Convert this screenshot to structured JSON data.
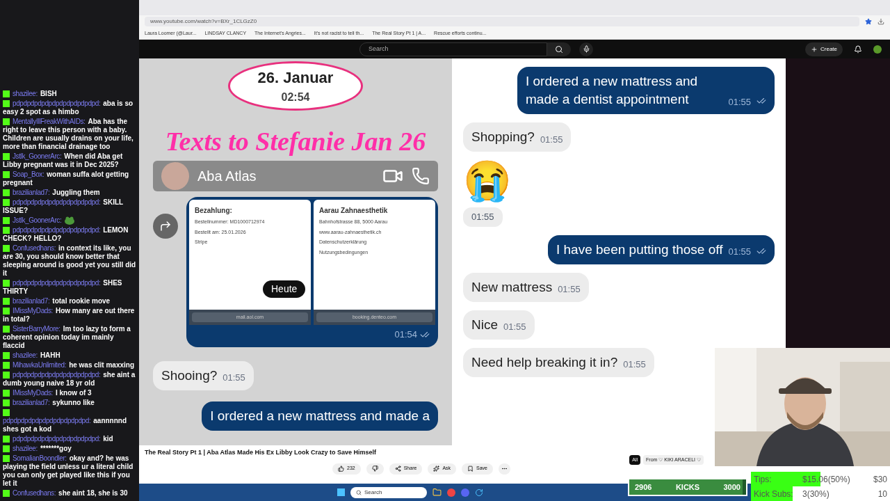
{
  "chat": [
    {
      "kind": "text",
      "user": "shazilee:",
      "text": "BISH"
    },
    {
      "kind": "text",
      "user": "pdpdpdpdpdpdpdpdpdpdpdpd:",
      "text": "aba is so easy 2 spot as a himbo"
    },
    {
      "kind": "text",
      "user": "MentallyIllFreakWithAIDs:",
      "text": "Aba has the right to leave this person with a baby. Children are usually drains on your life, more than financial drainage too"
    },
    {
      "kind": "text",
      "user": "Jstlk_GoonerArc:",
      "text": "When did Aba get Libby pregnant was it in Dec 2025?"
    },
    {
      "kind": "text",
      "user": "Soap_Box:",
      "text": "woman suffa alot getting pregnant"
    },
    {
      "kind": "text",
      "user": "brazilianlad7:",
      "text": "Juggling them"
    },
    {
      "kind": "text",
      "user": "pdpdpdpdpdpdpdpdpdpdpdpd:",
      "text": "SKILL ISSUE?"
    },
    {
      "kind": "emote",
      "user": "Jstlk_GoonerArc:"
    },
    {
      "kind": "text",
      "user": "pdpdpdpdpdpdpdpdpdpdpdpd:",
      "text": "LEMON CHECK? HELLO?"
    },
    {
      "kind": "text",
      "user": "Confusedhans:",
      "text": "in context its like, you are 30, you should know better that sleeping around is good yet you still did it"
    },
    {
      "kind": "text",
      "user": "pdpdpdpdpdpdpdpdpdpdpdpd:",
      "text": "SHES THIRTY"
    },
    {
      "kind": "text",
      "user": "brazilianlad7:",
      "text": "total rookie move"
    },
    {
      "kind": "text",
      "user": "IMissMyDads:",
      "text": "How many are out there in total?"
    },
    {
      "kind": "text",
      "user": "SisterBarryMore:",
      "text": "Im too lazy to form a coherent opinion today im mainly flaccid"
    },
    {
      "kind": "text",
      "user": "shazilee:",
      "text": "HAHH"
    },
    {
      "kind": "text",
      "user": "MihawkaUnlimited:",
      "text": "he was clit maxxing"
    },
    {
      "kind": "text",
      "user": "pdpdpdpdpdpdpdpdpdpdpdpd:",
      "text": "she aint a dumb young naive 18 yr old"
    },
    {
      "kind": "text",
      "user": "IMissMyDads:",
      "text": "I know of 3"
    },
    {
      "kind": "text",
      "user": "brazilianlad7:",
      "text": "sykunno like"
    },
    {
      "kind": "text",
      "user": "pdpdpdpdpdpdpdpdpdpdpdpd:",
      "text": "aannnnnd shes got a kod"
    },
    {
      "kind": "text",
      "user": "pdpdpdpdpdpdpdpdpdpdpdpd:",
      "text": "kid"
    },
    {
      "kind": "text",
      "user": "shazilee:",
      "text": "*******goy"
    },
    {
      "kind": "text",
      "user": "SomalianBoondler:",
      "text": "okay and? he was playing the field unless ur a literal child you can only get played like this if you let it"
    },
    {
      "kind": "text",
      "user": "Confusedhans:",
      "text": "she aint 18, she is 30"
    }
  ],
  "browser": {
    "url": "www.youtube.com/watch?v=BXr_1CLGzZ0",
    "bookmarks": [
      "Laura Loomer (@Laur...",
      "LINDSAY CLANCY",
      "The Internet's Angries...",
      "It's not racist to tell th...",
      "The Real Story Pt 1 | A...",
      "Rescue efforts continu..."
    ]
  },
  "youtube": {
    "search_placeholder": "Search",
    "create": "Create"
  },
  "video": {
    "left": {
      "date": "26. Januar",
      "time": "02:54",
      "overlay_title": "Texts to Stefanie Jan 26",
      "contact": "Aba Atlas",
      "day_badge": "Heute",
      "screens": [
        {
          "heading": "Bezahlung:",
          "lines": [
            "Bestellnummer: MD1000712974",
            "Bestellt am: 25.01.2026",
            "Stripe"
          ],
          "address": "mail.aol.com"
        },
        {
          "heading": "Aarau Zahnaesthetik",
          "lines": [
            "Bahnhofstrasse 88, 5000 Aarau",
            "www.aarau-zahnaesthetik.ch",
            "Datenschutzerklärung",
            "Nutzungsbedingungen"
          ],
          "address": "booking.denteo.com"
        }
      ],
      "image_time": "01:54",
      "messages": [
        {
          "kind": "received",
          "text": "Shooing?",
          "time": "01:55"
        },
        {
          "kind": "sent",
          "text": "I ordered a new mattress and made a"
        }
      ]
    },
    "right": {
      "messages": [
        {
          "kind": "sent",
          "text": "I ordered a new mattress and made a dentist appointment",
          "time": "01:55"
        },
        {
          "kind": "received",
          "text": "Shopping?",
          "time": "01:55"
        },
        {
          "kind": "emoji",
          "text": "😭",
          "time": "01:55"
        },
        {
          "kind": "sent",
          "text": "I have been putting those off",
          "time": "01:55"
        },
        {
          "kind": "received",
          "text": "New mattress",
          "time": "01:55"
        },
        {
          "kind": "received",
          "text": "Nice",
          "time": "01:55"
        },
        {
          "kind": "received",
          "text": "Need help breaking it in?",
          "time": "01:55"
        }
      ]
    }
  },
  "below": {
    "title": "The Real Story Pt 1 | Aba Atlas Made His Ex Libby Look Crazy to Save Himself",
    "likes": "232",
    "actions": [
      "Share",
      "Ask",
      "Save"
    ],
    "chips": [
      {
        "label": "All",
        "selected": true
      },
      {
        "label": "From ♡ KIKI ARACELI ♡",
        "selected": false
      }
    ]
  },
  "taskbar": {
    "search": "Search"
  },
  "goals": {
    "kicks": {
      "current": "2906",
      "label": "KICKS",
      "target": "3000",
      "level": 0.97
    },
    "rows": [
      {
        "label": "Tips:",
        "value": "$15.06(50%)",
        "target": "$30",
        "level": 0.5
      },
      {
        "label": "Kick Subs:",
        "value": "3(30%)",
        "target": "10",
        "level": 0.3
      }
    ]
  }
}
